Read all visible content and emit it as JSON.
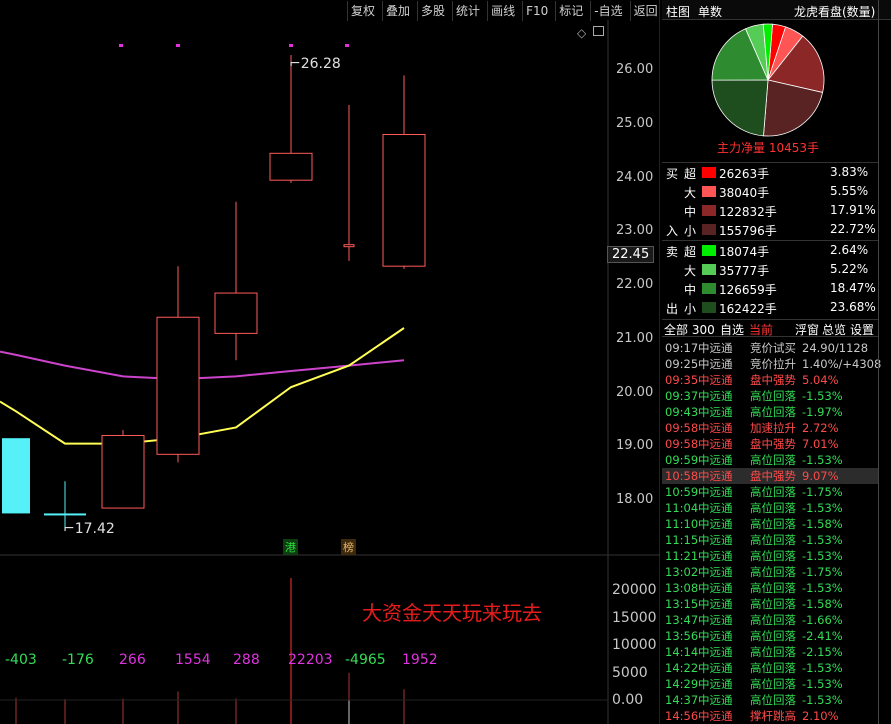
{
  "toolbar": [
    "复权",
    "叠加",
    "多股",
    "统计",
    "画线",
    "F10",
    "标记",
    "-自选",
    "返回"
  ],
  "side_panel": {
    "tab_bar": "柱图",
    "tab_count": "单数",
    "mode": "龙虎看盘(数量)",
    "net_label": "主力净量 10453手"
  },
  "colors": {
    "up": "#ff4444",
    "down": "#33dd55",
    "neutral": "#cccccc",
    "candle_up": "#ff5a5a",
    "candle_down": "#55f0f8",
    "ma1": "#ffff55",
    "ma2": "#cc44cc",
    "purple": "#e033e0"
  },
  "flow": {
    "buy": [
      {
        "lvl": "超",
        "vol": "26263手",
        "pct": "3.83%",
        "color": "#ff0000",
        "side": "买"
      },
      {
        "lvl": "大",
        "vol": "38040手",
        "pct": "5.55%",
        "color": "#ff5555",
        "side": ""
      },
      {
        "lvl": "中",
        "vol": "122832手",
        "pct": "17.91%",
        "color": "#8b2727",
        "side": ""
      },
      {
        "lvl": "小",
        "vol": "155796手",
        "pct": "22.72%",
        "color": "#5a2323",
        "side": "入"
      }
    ],
    "sell": [
      {
        "lvl": "超",
        "vol": "18074手",
        "pct": "2.64%",
        "color": "#00ee00",
        "side": "卖"
      },
      {
        "lvl": "大",
        "vol": "35777手",
        "pct": "5.22%",
        "color": "#55cc55",
        "side": ""
      },
      {
        "lvl": "中",
        "vol": "126659手",
        "pct": "18.47%",
        "color": "#2f8b2f",
        "side": ""
      },
      {
        "lvl": "小",
        "vol": "162422手",
        "pct": "23.68%",
        "color": "#1e4e1e",
        "side": "出"
      }
    ]
  },
  "tabs": {
    "all": "全部 300",
    "custom": "自选",
    "current": "当前",
    "float": "浮窗",
    "overview": "总览",
    "settings": "设置"
  },
  "tape": [
    {
      "t": "09:17",
      "n": "中远通",
      "e": "竞价试买",
      "v": "24.90/1128",
      "c": "n"
    },
    {
      "t": "09:25",
      "n": "中远通",
      "e": "竞价拉升",
      "v": "1.40%/+4308",
      "c": "n"
    },
    {
      "t": "09:35",
      "n": "中远通",
      "e": "盘中强势",
      "v": "5.04%",
      "c": "u"
    },
    {
      "t": "09:37",
      "n": "中远通",
      "e": "高位回落",
      "v": "-1.53%",
      "c": "d"
    },
    {
      "t": "09:43",
      "n": "中远通",
      "e": "高位回落",
      "v": "-1.97%",
      "c": "d"
    },
    {
      "t": "09:58",
      "n": "中远通",
      "e": "加速拉升",
      "v": "2.72%",
      "c": "u"
    },
    {
      "t": "09:58",
      "n": "中远通",
      "e": "盘中强势",
      "v": "7.01%",
      "c": "u"
    },
    {
      "t": "09:59",
      "n": "中远通",
      "e": "高位回落",
      "v": "-1.53%",
      "c": "d"
    },
    {
      "t": "10:58",
      "n": "中远通",
      "e": "盘中强势",
      "v": "9.07%",
      "c": "u",
      "sel": true
    },
    {
      "t": "10:59",
      "n": "中远通",
      "e": "高位回落",
      "v": "-1.75%",
      "c": "d"
    },
    {
      "t": "11:04",
      "n": "中远通",
      "e": "高位回落",
      "v": "-1.53%",
      "c": "d"
    },
    {
      "t": "11:10",
      "n": "中远通",
      "e": "高位回落",
      "v": "-1.58%",
      "c": "d"
    },
    {
      "t": "11:15",
      "n": "中远通",
      "e": "高位回落",
      "v": "-1.53%",
      "c": "d"
    },
    {
      "t": "11:21",
      "n": "中远通",
      "e": "高位回落",
      "v": "-1.53%",
      "c": "d"
    },
    {
      "t": "13:02",
      "n": "中远通",
      "e": "高位回落",
      "v": "-1.75%",
      "c": "d"
    },
    {
      "t": "13:08",
      "n": "中远通",
      "e": "高位回落",
      "v": "-1.53%",
      "c": "d"
    },
    {
      "t": "13:15",
      "n": "中远通",
      "e": "高位回落",
      "v": "-1.58%",
      "c": "d"
    },
    {
      "t": "13:47",
      "n": "中远通",
      "e": "高位回落",
      "v": "-1.66%",
      "c": "d"
    },
    {
      "t": "13:56",
      "n": "中远通",
      "e": "高位回落",
      "v": "-2.41%",
      "c": "d"
    },
    {
      "t": "14:14",
      "n": "中远通",
      "e": "高位回落",
      "v": "-2.15%",
      "c": "d"
    },
    {
      "t": "14:22",
      "n": "中远通",
      "e": "高位回落",
      "v": "-1.53%",
      "c": "d"
    },
    {
      "t": "14:29",
      "n": "中远通",
      "e": "高位回落",
      "v": "-1.53%",
      "c": "d"
    },
    {
      "t": "14:37",
      "n": "中远通",
      "e": "高位回落",
      "v": "-1.53%",
      "c": "d"
    },
    {
      "t": "14:56",
      "n": "中远通",
      "e": "撑杆跳高",
      "v": "2.10%",
      "c": "u"
    }
  ],
  "chart_data": {
    "type": "candlestick",
    "price_axis": [
      "26.00",
      "25.00",
      "24.00",
      "23.00",
      "22.00",
      "21.00",
      "20.00",
      "19.00",
      "18.00"
    ],
    "last_price": "22.45",
    "high_label": "26.28",
    "low_label": "17.42",
    "ylim": [
      17.3,
      26.9
    ],
    "candles": [
      {
        "open": 19.15,
        "high": 19.15,
        "low": 17.75,
        "close": 17.75,
        "dir": "down"
      },
      {
        "open": 17.75,
        "high": 18.35,
        "low": 17.42,
        "close": 17.75,
        "dir": "down"
      },
      {
        "open": 17.85,
        "high": 19.3,
        "low": 17.85,
        "close": 19.2,
        "dir": "up"
      },
      {
        "open": 18.85,
        "high": 22.35,
        "low": 18.7,
        "close": 21.4,
        "dir": "up"
      },
      {
        "open": 21.1,
        "high": 23.55,
        "low": 20.6,
        "close": 21.85,
        "dir": "up"
      },
      {
        "open": 23.95,
        "high": 26.28,
        "low": 23.9,
        "close": 24.45,
        "dir": "up"
      },
      {
        "open": 22.75,
        "high": 25.35,
        "low": 22.45,
        "close": 22.75,
        "dir": "up"
      },
      {
        "open": 22.35,
        "high": 25.9,
        "low": 22.3,
        "close": 24.8,
        "dir": "up"
      }
    ],
    "ma1": [
      19.65,
      19.05,
      19.05,
      19.15,
      19.35,
      20.1,
      20.5,
      21.2
    ],
    "ma2": [
      20.7,
      20.5,
      20.3,
      20.25,
      20.3,
      20.4,
      20.5,
      20.6
    ],
    "volume_axis": [
      "20000",
      "15000",
      "10000",
      "5000",
      "0.00"
    ],
    "volume_ylim": [
      0,
      22203
    ],
    "volume_labels": [
      "-403",
      "-176",
      "266",
      "1554",
      "288",
      "22203",
      "-4965",
      "1952"
    ],
    "volume_values": [
      403,
      176,
      266,
      1554,
      288,
      22203,
      4965,
      1952
    ],
    "annotation": "大资金天天玩来玩去",
    "badges": [
      "港",
      "榜"
    ]
  }
}
